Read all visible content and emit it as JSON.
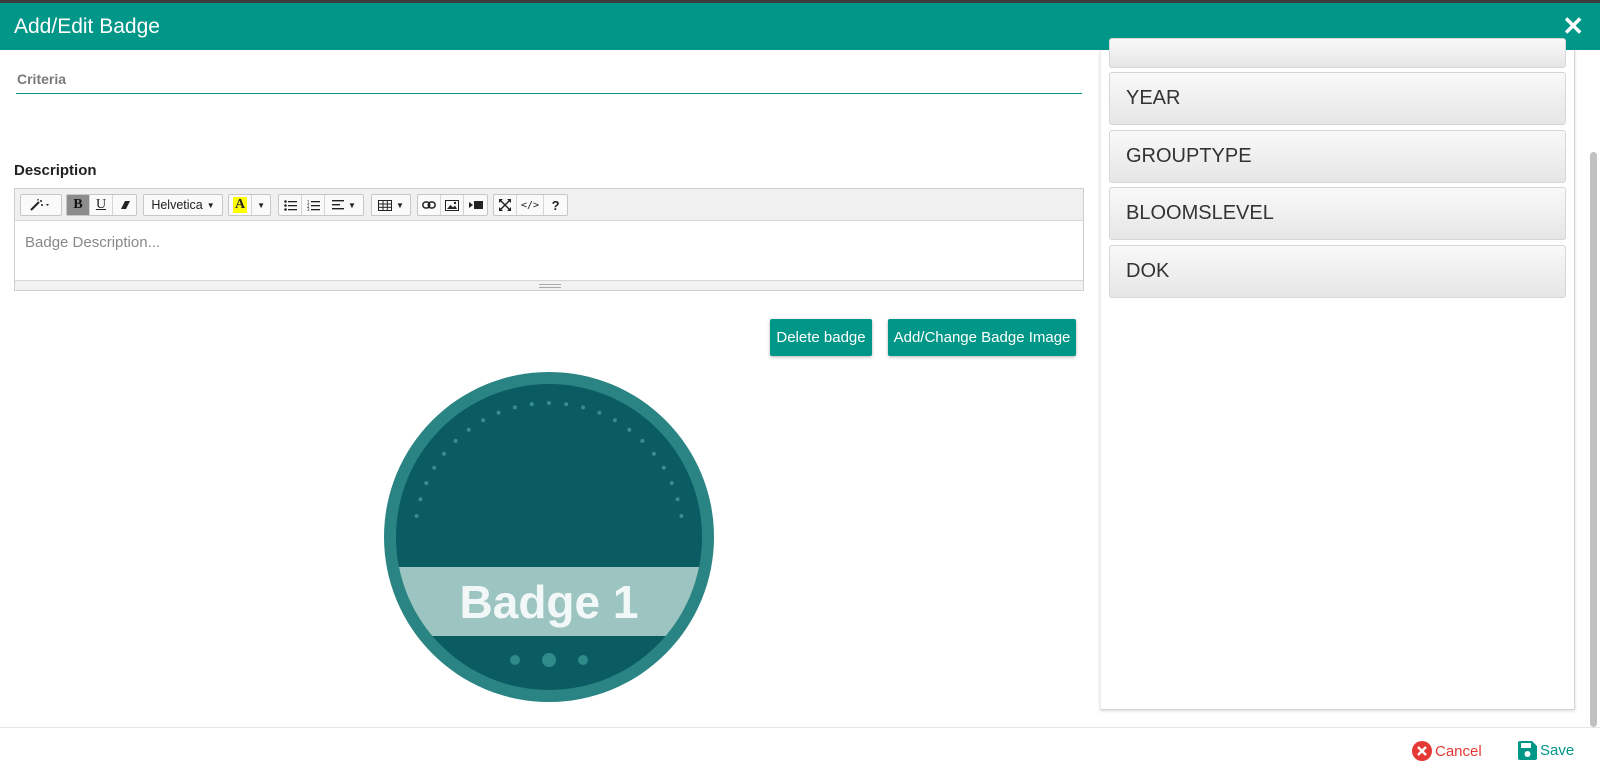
{
  "header": {
    "title": "Add/Edit Badge",
    "close_icon": "close-icon"
  },
  "form": {
    "criteria_label": "Criteria",
    "description_label": "Description",
    "description_placeholder": "Badge Description..."
  },
  "editor_toolbar": {
    "style_icon": "magic-wand-icon",
    "bold": "B",
    "underline": "U",
    "clear_format_icon": "eraser-icon",
    "font_name": "Helvetica",
    "color_letter": "A",
    "highlight_color": "#ffff00",
    "unordered_list_icon": "bullet-list-icon",
    "ordered_list_icon": "numbered-list-icon",
    "align_icon": "align-left-icon",
    "table_icon": "table-icon",
    "link_icon": "link-icon",
    "picture_icon": "picture-icon",
    "video_icon": "video-icon",
    "fullscreen_icon": "fullscreen-icon",
    "codeview_label": "</>",
    "help_label": "?"
  },
  "buttons": {
    "delete_badge": "Delete badge",
    "add_change_image": "Add/Change Badge Image"
  },
  "badge_image": {
    "label": "Badge 1",
    "outer_color": "#2a8484",
    "inner_color": "#0a5c62",
    "band_color": "#9cc5c2"
  },
  "tag_list": [
    "YEAR",
    "GROUPTYPE",
    "BLOOMSLEVEL",
    "DOK"
  ],
  "footer": {
    "cancel": "Cancel",
    "save": "Save"
  },
  "colors": {
    "accent": "#009688",
    "cancel": "#e53935"
  }
}
